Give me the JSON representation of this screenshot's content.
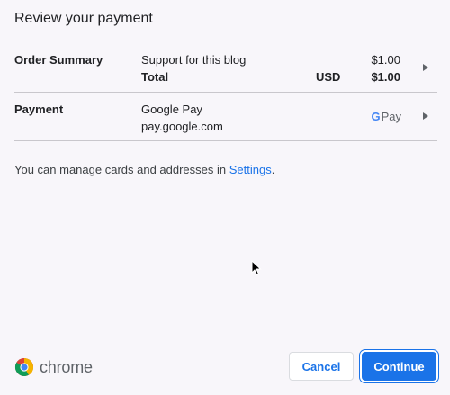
{
  "dialog": {
    "title": "Review your payment"
  },
  "order_summary": {
    "label": "Order Summary",
    "item_name": "Support for this blog",
    "item_price": "$1.00",
    "total_label": "Total",
    "currency": "USD",
    "total_price": "$1.00"
  },
  "payment": {
    "label": "Payment",
    "method_name": "Google Pay",
    "method_domain": "pay.google.com",
    "logo_g": "G",
    "logo_text": "Pay"
  },
  "info": {
    "text": "You can manage cards and addresses in ",
    "link": "Settings",
    "suffix": "."
  },
  "footer": {
    "brand": "chrome",
    "cancel_label": "Cancel",
    "continue_label": "Continue"
  },
  "colors": {
    "accent": "#1a73e8",
    "background": "#f8f6fa",
    "divider": "#c9c7cc"
  }
}
